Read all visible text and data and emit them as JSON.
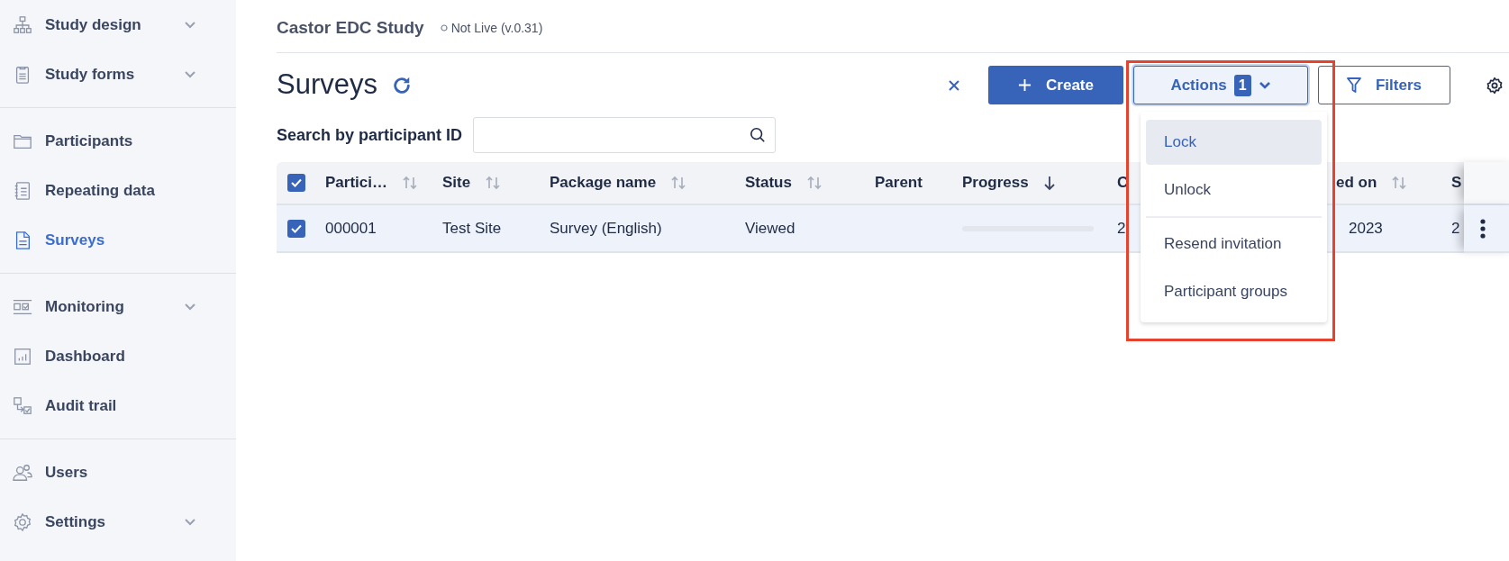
{
  "sidebar": {
    "groups": [
      {
        "items": [
          {
            "label": "Study design",
            "kind": "sitemap",
            "expandable": true,
            "selected": false
          },
          {
            "label": "Study forms",
            "kind": "clipboard",
            "expandable": true,
            "selected": false
          }
        ]
      },
      {
        "items": [
          {
            "label": "Participants",
            "kind": "folder",
            "expandable": false,
            "selected": false
          },
          {
            "label": "Repeating data",
            "kind": "notebook",
            "expandable": false,
            "selected": false
          },
          {
            "label": "Surveys",
            "kind": "document",
            "expandable": false,
            "selected": true
          }
        ]
      },
      {
        "items": [
          {
            "label": "Monitoring",
            "kind": "monitor",
            "expandable": true,
            "selected": false
          },
          {
            "label": "Dashboard",
            "kind": "chart",
            "expandable": false,
            "selected": false
          },
          {
            "label": "Audit trail",
            "kind": "audit",
            "expandable": false,
            "selected": false
          }
        ]
      },
      {
        "items": [
          {
            "label": "Users",
            "kind": "users",
            "expandable": false,
            "selected": false
          },
          {
            "label": "Settings",
            "kind": "gear",
            "expandable": true,
            "selected": false
          }
        ]
      }
    ]
  },
  "header": {
    "study_title": "Castor EDC Study",
    "status": "Not Live (v.0.31)"
  },
  "page": {
    "title": "Surveys"
  },
  "toolbar": {
    "create_label": "Create",
    "actions": {
      "label": "Actions",
      "count": "1",
      "expanded": true
    },
    "filters_label": "Filters"
  },
  "actions_menu": {
    "groups": [
      {
        "items": [
          {
            "label": "Lock",
            "selected": true
          },
          {
            "label": "Unlock",
            "selected": false
          }
        ]
      },
      {
        "items": [
          {
            "label": "Resend invitation",
            "selected": false
          },
          {
            "label": "Participant groups",
            "selected": false
          }
        ]
      }
    ]
  },
  "search": {
    "label": "Search by participant ID"
  },
  "table": {
    "header_checked": true,
    "columns": [
      {
        "label": "Partici…",
        "sortable": true,
        "sorted": false
      },
      {
        "label": "Site",
        "sortable": true,
        "sorted": false
      },
      {
        "label": "Package name",
        "sortable": true,
        "sorted": false
      },
      {
        "label": "Status",
        "sortable": true,
        "sorted": false
      },
      {
        "label": "Parent",
        "sortable": false,
        "sorted": false
      },
      {
        "label": "Progress",
        "sortable": true,
        "sorted": true
      },
      {
        "label": "C",
        "sortable": false,
        "sorted": false
      },
      {
        "label": "ed on",
        "sortable": true,
        "sorted": false
      },
      {
        "label": "S",
        "sortable": false,
        "sorted": false
      }
    ],
    "rows": [
      {
        "selected": true,
        "participant": "000001",
        "site": "Test Site",
        "package": "Survey (English)",
        "status": "Viewed",
        "progress": {
          "level": 0
        },
        "column_7": "2",
        "column_8": "2023",
        "column_9": "2"
      }
    ]
  }
}
